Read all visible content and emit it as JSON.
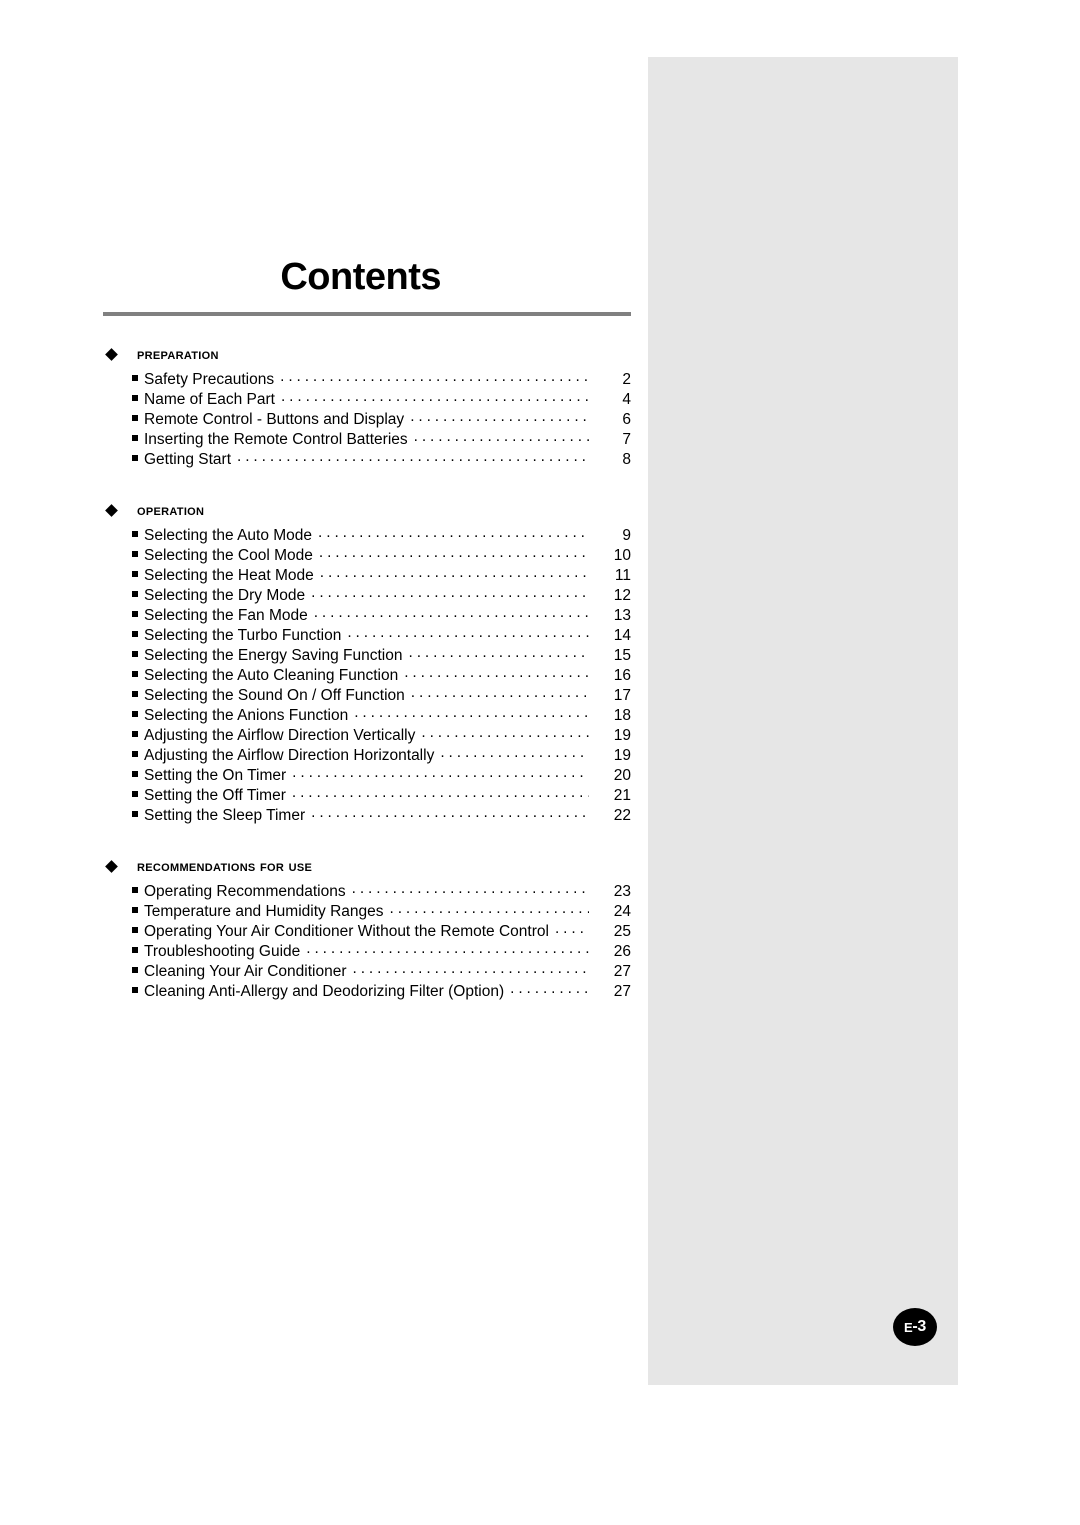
{
  "document": {
    "title": "Contents",
    "page_badge": "E-3",
    "page_badge_prefix": "E",
    "page_badge_suffix": "-3"
  },
  "sections": [
    {
      "heading": "Preparation",
      "bullet_icon": "diamond-icon",
      "entries": [
        {
          "label": "Safety Precautions",
          "page": "2"
        },
        {
          "label": "Name of Each Part",
          "page": "4"
        },
        {
          "label": "Remote Control - Buttons and Display",
          "page": "6"
        },
        {
          "label": "Inserting the Remote Control Batteries",
          "page": "7"
        },
        {
          "label": "Getting Start",
          "page": "8"
        }
      ]
    },
    {
      "heading": "Operation",
      "bullet_icon": "diamond-icon",
      "entries": [
        {
          "label": "Selecting the Auto Mode",
          "page": "9"
        },
        {
          "label": "Selecting the Cool Mode",
          "page": "10"
        },
        {
          "label": "Selecting the Heat Mode",
          "page": "11"
        },
        {
          "label": "Selecting the Dry Mode",
          "page": "12"
        },
        {
          "label": "Selecting the Fan Mode",
          "page": "13"
        },
        {
          "label": "Selecting the Turbo Function",
          "page": "14"
        },
        {
          "label": "Selecting the Energy Saving Function",
          "page": "15"
        },
        {
          "label": "Selecting the Auto Cleaning Function",
          "page": "16"
        },
        {
          "label": "Selecting the Sound On / Off Function",
          "page": "17"
        },
        {
          "label": "Selecting the Anions Function",
          "page": "18"
        },
        {
          "label": "Adjusting the Airflow Direction Vertically",
          "page": "19"
        },
        {
          "label": "Adjusting the Airflow Direction Horizontally",
          "page": "19"
        },
        {
          "label": "Setting the On Timer",
          "page": "20"
        },
        {
          "label": "Setting the Off Timer",
          "page": "21"
        },
        {
          "label": "Setting the Sleep Timer",
          "page": "22"
        }
      ]
    },
    {
      "heading": "Recommendations for use",
      "bullet_icon": "diamond-icon",
      "entries": [
        {
          "label": "Operating Recommendations",
          "page": "23"
        },
        {
          "label": "Temperature and Humidity Ranges",
          "page": "24"
        },
        {
          "label": "Operating Your Air Conditioner Without the Remote Control",
          "page": "25"
        },
        {
          "label": "Troubleshooting Guide",
          "page": "26"
        },
        {
          "label": "Cleaning Your Air Conditioner",
          "page": "27"
        },
        {
          "label": "Cleaning Anti-Allergy and Deodorizing Filter (Option)",
          "page": "27"
        }
      ]
    }
  ],
  "style": {
    "panel_color": "#e6e6e6",
    "rule_color": "#808080",
    "badge_color": "#000000",
    "text_color": "#000000"
  }
}
